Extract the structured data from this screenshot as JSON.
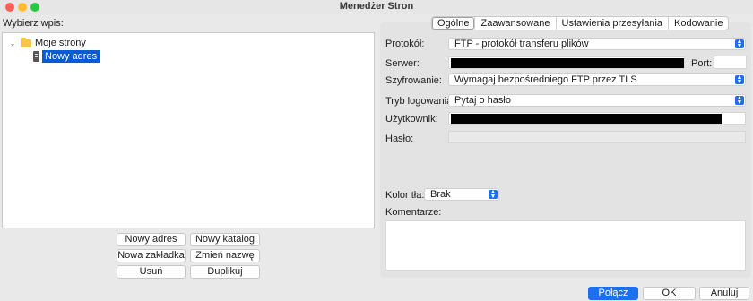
{
  "window": {
    "title": "Menedżer Stron"
  },
  "tree": {
    "label": "Wybierz wpis:",
    "folder_label": "Moje strony",
    "entry_label": "Nowy adres"
  },
  "left_buttons": {
    "new_site": "Nowy adres",
    "new_folder": "Nowy katalog",
    "new_bookmark": "Nowa zakładka",
    "rename": "Zmień nazwę",
    "delete": "Usuń",
    "duplicate": "Duplikuj"
  },
  "tabs": [
    "Ogólne",
    "Zaawansowane",
    "Ustawienia przesyłania",
    "Kodowanie"
  ],
  "general": {
    "protocol_label": "Protokół:",
    "protocol_value": "FTP - protokół transferu plików",
    "server_label": "Serwer:",
    "port_label": "Port:",
    "encryption_label": "Szyfrowanie:",
    "encryption_value": "Wymagaj bezpośredniego FTP przez TLS",
    "logon_label": "Tryb logowania:",
    "logon_value": "Pytaj o hasło",
    "user_label": "Użytkownik:",
    "password_label": "Hasło:",
    "bg_color_label": "Kolor tła:",
    "bg_color_value": "Brak",
    "comments_label": "Komentarze:"
  },
  "footer": {
    "connect": "Połącz",
    "ok": "OK",
    "cancel": "Anuluj"
  },
  "colors": {
    "accent": "#1d6ff0",
    "close": "#ff5f57",
    "minimize": "#febc2e",
    "zoom": "#28c840"
  }
}
